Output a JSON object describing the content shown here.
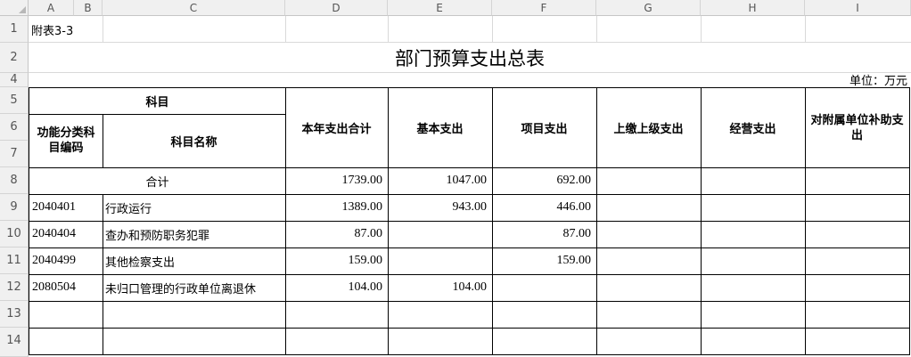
{
  "columns": [
    "A",
    "B",
    "C",
    "D",
    "E",
    "F",
    "G",
    "H",
    "I"
  ],
  "rows": [
    "1",
    "2",
    "4",
    "5",
    "6",
    "7",
    "8",
    "9",
    "10",
    "11",
    "12",
    "13",
    "14"
  ],
  "sheet": {
    "note": "附表3-3",
    "title": "部门预算支出总表",
    "unit": "单位：万元"
  },
  "headers": {
    "subject": "科目",
    "func_code": "功能分类科目编码",
    "subject_name": "科目名称",
    "total": "本年支出合计",
    "basic": "基本支出",
    "project": "项目支出",
    "upper": "上缴上级支出",
    "operating": "经营支出",
    "subsidy": "对附属单位补助支出"
  },
  "total_row": {
    "label": "合计",
    "total": "1739.00",
    "basic": "1047.00",
    "project": "692.00"
  },
  "data_rows": [
    {
      "code": "2040401",
      "name": "行政运行",
      "total": "1389.00",
      "basic": "943.00",
      "project": "446.00"
    },
    {
      "code": "2040404",
      "name": "查办和预防职务犯罪",
      "total": "87.00",
      "basic": "",
      "project": "87.00"
    },
    {
      "code": "2040499",
      "name": "其他检察支出",
      "total": "159.00",
      "basic": "",
      "project": "159.00"
    },
    {
      "code": "2080504",
      "name": "未归口管理的行政单位离退休",
      "total": "104.00",
      "basic": "104.00",
      "project": ""
    }
  ]
}
